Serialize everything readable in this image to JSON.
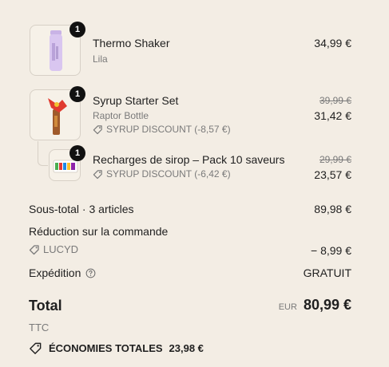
{
  "items": [
    {
      "quantity": "1",
      "name": "Thermo Shaker",
      "variant": "Lila",
      "price": "34,99 €"
    },
    {
      "quantity": "1",
      "name": "Syrup Starter Set",
      "variant": "Raptor Bottle",
      "discount": "SYRUP DISCOUNT (-8,57 €)",
      "old_price": "39,99 €",
      "price": "31,42 €"
    },
    {
      "quantity": "1",
      "name": "Recharges de sirop – Pack 10 saveurs",
      "discount": "SYRUP DISCOUNT (-6,42 €)",
      "old_price": "29,99 €",
      "price": "23,57 €"
    }
  ],
  "summary": {
    "subtotal_label": "Sous-total · 3 articles",
    "subtotal_value": "89,98 €",
    "order_discount_label": "Réduction sur la commande",
    "discount_code": "LUCYD",
    "discount_value": "− 8,99 €",
    "shipping_label": "Expédition",
    "shipping_value": "GRATUIT"
  },
  "total": {
    "label": "Total",
    "currency": "EUR",
    "value": "80,99 €",
    "tax_note": "TTC",
    "savings_label": "ÉCONOMIES TOTALES",
    "savings_value": "23,98 €"
  },
  "icons": {
    "tag": "tag-icon",
    "help": "help-circle-icon"
  },
  "colors": {
    "background": "#f3ede4",
    "badge": "#111111",
    "muted": "#7a7a7a"
  }
}
